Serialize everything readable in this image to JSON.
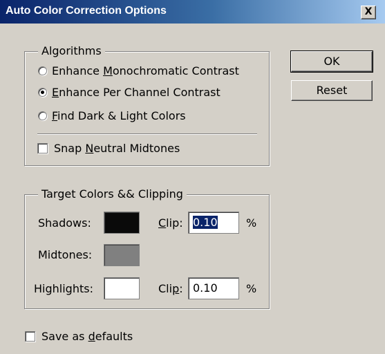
{
  "dialog": {
    "title": "Auto Color Correction Options",
    "close_label": "X"
  },
  "algorithms": {
    "legend": "Algorithms",
    "options": [
      {
        "pre": "Enhance ",
        "mnemonic": "M",
        "post": "onochromatic Contrast",
        "checked": false
      },
      {
        "pre": "",
        "mnemonic": "E",
        "post": "nhance Per Channel Contrast",
        "checked": true
      },
      {
        "pre": "",
        "mnemonic": "F",
        "post": "ind Dark & Light Colors",
        "checked": false
      }
    ],
    "snap_neutral": {
      "pre": "Snap ",
      "mnemonic": "N",
      "post": "eutral Midtones",
      "checked": false
    }
  },
  "target": {
    "legend": "Target Colors && Clipping",
    "shadows_label": "Shadows:",
    "midtones_label": "Midtones:",
    "highlights_label": "Highlights:",
    "shadows_color": "#0a0a0a",
    "midtones_color": "#808080",
    "highlights_color": "#ffffff",
    "clip_shadows": {
      "mnemonic": "C",
      "post": "lip:",
      "value": "0.10",
      "unit": "%"
    },
    "clip_highlights": {
      "pre": "Cli",
      "mnemonic": "p",
      "post": ":",
      "value": "0.10",
      "unit": "%"
    }
  },
  "buttons": {
    "ok": "OK",
    "reset": "Reset"
  },
  "save_defaults": {
    "pre": "Save as ",
    "mnemonic": "d",
    "post": "efaults",
    "checked": false
  }
}
